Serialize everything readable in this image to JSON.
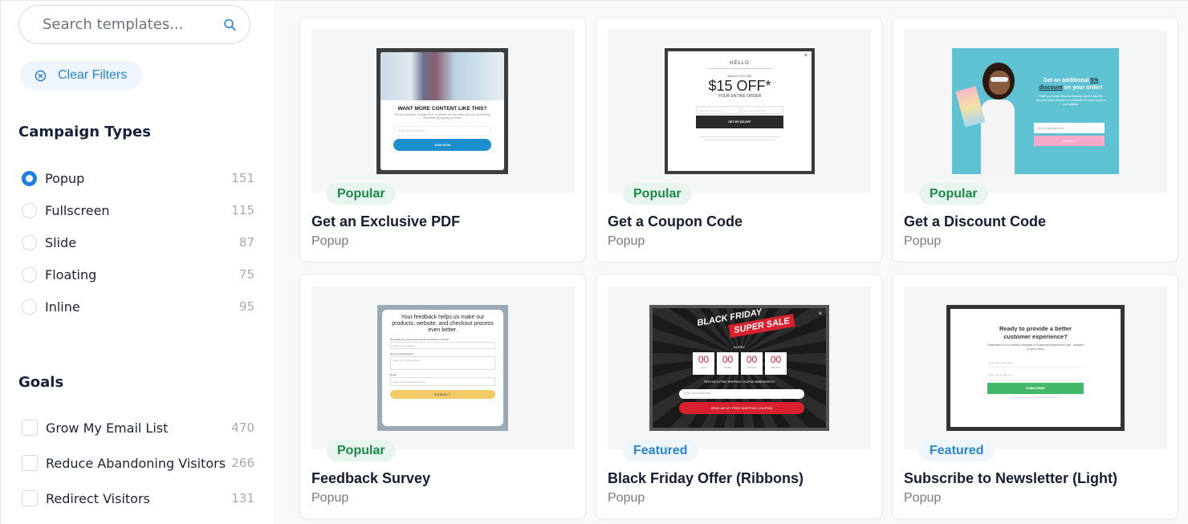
{
  "search": {
    "placeholder": "Search templates...",
    "value": ""
  },
  "clear_filters": {
    "label": "Clear Filters"
  },
  "campaign_types": {
    "title": "Campaign Types",
    "items": [
      {
        "label": "Popup",
        "count": "151",
        "selected": true
      },
      {
        "label": "Fullscreen",
        "count": "115",
        "selected": false
      },
      {
        "label": "Slide",
        "count": "87",
        "selected": false
      },
      {
        "label": "Floating",
        "count": "75",
        "selected": false
      },
      {
        "label": "Inline",
        "count": "95",
        "selected": false
      }
    ]
  },
  "goals": {
    "title": "Goals",
    "items": [
      {
        "label": "Grow My Email List",
        "count": "470",
        "checked": false
      },
      {
        "label": "Reduce Abandoning Visitors",
        "count": "266",
        "checked": false
      },
      {
        "label": "Redirect Visitors",
        "count": "131",
        "checked": false
      }
    ]
  },
  "colors": {
    "accent": "#1f7fe0",
    "popular_text": "#1a8a4a",
    "featured_text": "#2a85cf",
    "title_text": "#151d33"
  },
  "templates": [
    {
      "badge": "Popular",
      "title": "Get an Exclusive PDF",
      "type": "Popup",
      "preview": {
        "heading": "WANT MORE CONTENT LIKE THIS?",
        "body": "Get my exclusive 16-page PDF of pointers for free when you join my monthly newsletter by signing up below.",
        "input": "Enter your email here...",
        "button": "JOIN NOW"
      }
    },
    {
      "badge": "Popular",
      "title": "Get a Coupon Code",
      "type": "Popup",
      "preview": {
        "hello": "HELLO",
        "pre": "WOULD YOU LIKE",
        "offer": "$15 OFF*",
        "sub": "YOUR ENTIRE ORDER",
        "input1": "Enter your name here",
        "input2": "Enter your email here",
        "button": "GET MY $15 OFF",
        "close": "×"
      }
    },
    {
      "badge": "Popular",
      "title": "Get a Discount Code",
      "type": "Popup",
      "preview": {
        "heading_a": "Get an additional ",
        "heading_pct": "5% discount",
        "heading_b": " on your order!",
        "body": "Enter your email below to instantly receive your 5% discount code, and join our newsletter for more coupons and updates.",
        "input": "Your email address",
        "button": "Submit »"
      }
    },
    {
      "badge": "Popular",
      "title": "Feedback Survey",
      "type": "Popup",
      "preview": {
        "heading": "Your feedback helps us make our products, website, and checkout process even better.",
        "q1": "How likely are you to recommend our brand to a friend?",
        "select": "Make your selection...",
        "q2": "How can we improve?",
        "textarea": "Enter your thoughts here...",
        "q3": "Email",
        "input": "Enter your email address here...",
        "button": "SUBMIT"
      }
    },
    {
      "badge": "Featured",
      "title": "Black Friday Offer (Ribbons)",
      "type": "Popup",
      "preview": {
        "ribbon1": "BLACK FRIDAY",
        "ribbon2": "SUPER SALE",
        "hurry": "HURRY",
        "timer": [
          {
            "v": "00",
            "u": "DAYS"
          },
          {
            "v": "00",
            "u": "HOURS"
          },
          {
            "v": "00",
            "u": "MINUTES"
          },
          {
            "v": "00",
            "u": "SECONDS"
          }
        ],
        "note": "RECEIVE A FREE SHIPPING COUPON IMMEDIATELY!",
        "input": "Enter your email here...",
        "button": "SEND ME MY FREE SHIPPING COUPON!",
        "close": "×"
      }
    },
    {
      "badge": "Featured",
      "title": "Subscribe to Newsletter (Light)",
      "type": "Popup",
      "preview": {
        "heading": "Ready to provide a better customer experience?",
        "body": "Subscribe to our weekly rundown of customer experience tips - straight to your inbox",
        "input1": "Enter your name here...",
        "input2": "Enter your email here...",
        "button": "SUBSCRIBE",
        "fine": "We do not sell or share your information with anyone."
      }
    }
  ]
}
